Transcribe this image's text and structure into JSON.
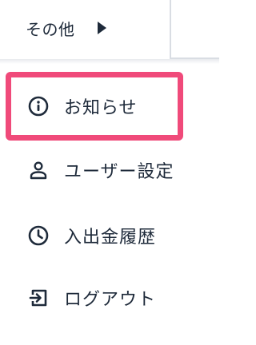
{
  "header": {
    "other_label": "その他"
  },
  "menu": {
    "items": [
      {
        "label": "お知らせ",
        "icon": "info-icon"
      },
      {
        "label": "ユーザー設定",
        "icon": "user-icon"
      },
      {
        "label": "入出金履歴",
        "icon": "clock-icon"
      },
      {
        "label": "ログアウト",
        "icon": "logout-icon"
      }
    ]
  },
  "colors": {
    "text": "#1e2a3a",
    "highlight": "#f04a7a"
  }
}
